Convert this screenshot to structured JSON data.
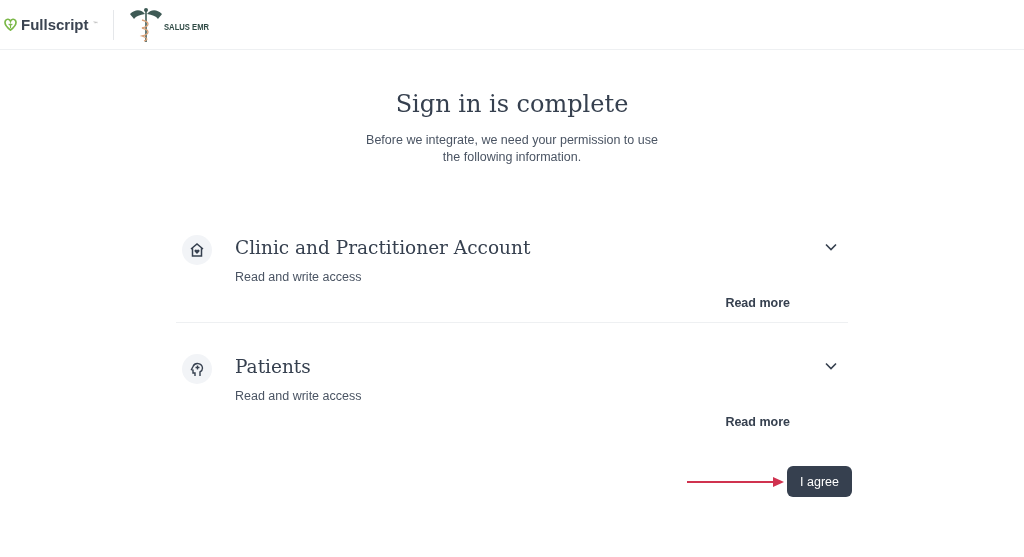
{
  "header": {
    "brand": "Fullscript",
    "brand_mark": "™",
    "partner": "SALUS EMR"
  },
  "title": "Sign in is complete",
  "subtitle": "Before we integrate, we need your permission to use the following information.",
  "permissions": [
    {
      "kind": "clinic",
      "title": "Clinic and Practitioner Account",
      "access": "Read and write access",
      "link": "Read more",
      "expanded": false
    },
    {
      "kind": "patients",
      "title": "Patients",
      "access": "Read and write access",
      "link": "Read more",
      "expanded": false
    }
  ],
  "button": "I agree"
}
